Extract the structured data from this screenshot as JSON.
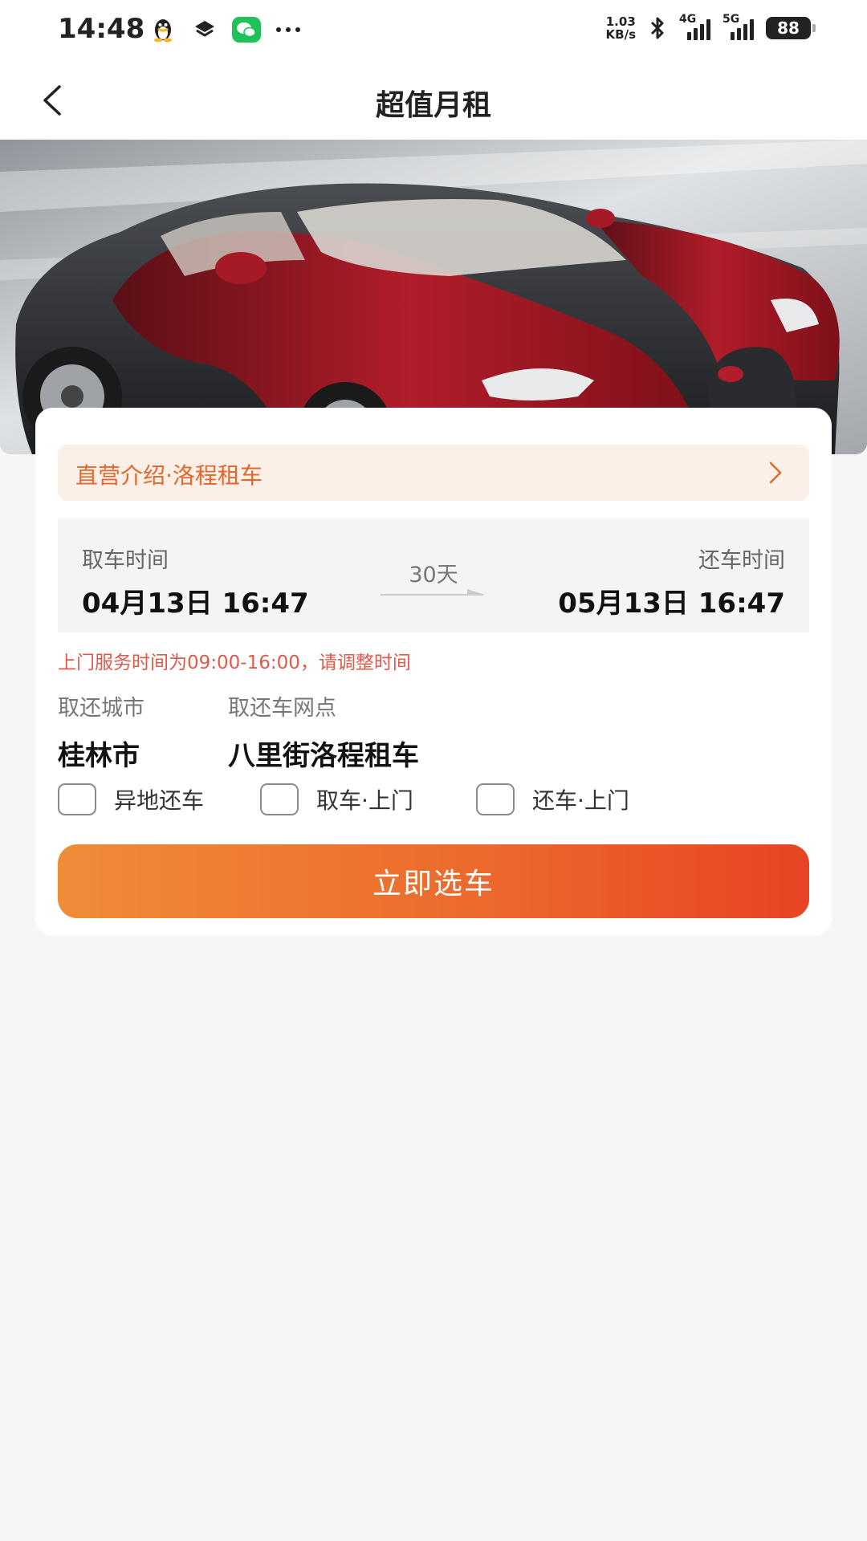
{
  "status_bar": {
    "time": "14:48",
    "net_speed_value": "1.03",
    "net_speed_unit": "KB/s",
    "signal_1_label": "4G",
    "signal_2_label": "5G",
    "battery": "88"
  },
  "header": {
    "title": "超值月租"
  },
  "hero": {
    "image_subject": "red-black-sports-car"
  },
  "intro": {
    "label": "直营介绍·洛程租车"
  },
  "rental_time": {
    "pickup_label": "取车时间",
    "pickup_value": "04月13日 16:47",
    "return_label": "还车时间",
    "return_value": "05月13日 16:47",
    "duration": "30天"
  },
  "warning": "上门服务时间为09:00-16:00，请调整时间",
  "location": {
    "city_label": "取还城市",
    "city_value": "桂林市",
    "store_label": "取还车网点",
    "store_value": "八里街洛程租车"
  },
  "options": [
    {
      "label": "异地还车",
      "checked": false
    },
    {
      "label": "取车·上门",
      "checked": false
    },
    {
      "label": "还车·上门",
      "checked": false
    }
  ],
  "cta": {
    "label": "立即选车"
  },
  "colors": {
    "accent_orange": "#e4672b",
    "warning_red": "#e05a4c",
    "cta_gradient_start": "#ef8c37",
    "cta_gradient_end": "#e84425",
    "intro_banner_bg": "#fbefe8"
  }
}
